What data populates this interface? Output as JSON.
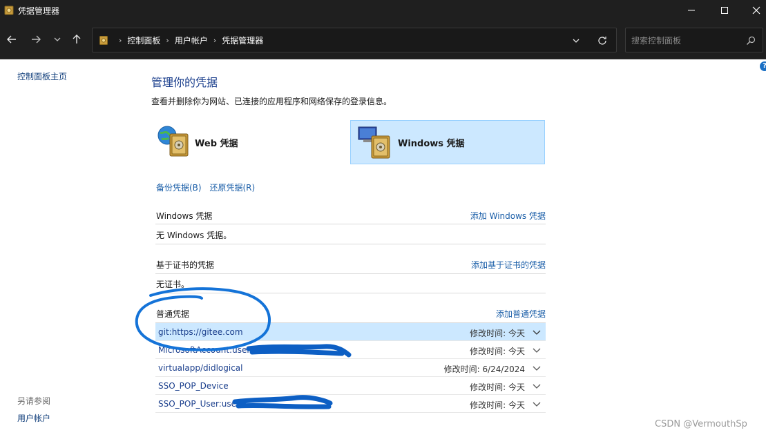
{
  "window": {
    "title": "凭据管理器"
  },
  "address_bar": {
    "breadcrumbs": [
      "控制面板",
      "用户帐户",
      "凭据管理器"
    ],
    "search_placeholder": "搜索控制面板"
  },
  "left_pane": {
    "home_link": "控制面板主页",
    "see_also_label": "另请参阅",
    "see_also_link": "用户帐户"
  },
  "main": {
    "heading": "管理你的凭据",
    "subtitle": "查看并删除你为网站、已连接的应用程序和网络保存的登录信息。",
    "credential_types": [
      {
        "label": "Web 凭据",
        "selected": false
      },
      {
        "label": "Windows 凭据",
        "selected": true
      }
    ],
    "backup_link": "备份凭据(B)",
    "restore_link": "还原凭据(R)",
    "sections": {
      "windows": {
        "title": "Windows 凭据",
        "add_link": "添加 Windows 凭据",
        "empty_text": "无 Windows 凭据。"
      },
      "certificate": {
        "title": "基于证书的凭据",
        "add_link": "添加基于证书的凭据",
        "empty_text": "无证书。"
      },
      "generic": {
        "title": "普通凭据",
        "add_link": "添加普通凭据",
        "items": [
          {
            "name": "git:https://gitee.com",
            "modified": "修改时间:  今天",
            "selected": true
          },
          {
            "name": "MicrosoftAccount:user=",
            "modified": "修改时间:  今天",
            "selected": false
          },
          {
            "name": "virtualapp/didlogical",
            "modified": "修改时间:  6/24/2024",
            "selected": false
          },
          {
            "name": "SSO_POP_Device",
            "modified": "修改时间:  今天",
            "selected": false
          },
          {
            "name": "SSO_POP_User:user=",
            "modified": "修改时间:  今天",
            "selected": false
          }
        ]
      }
    }
  },
  "watermark": "CSDN @VermouthSp",
  "colors": {
    "accent_blue": "#1a5ea8",
    "selected_bg": "#cce8ff",
    "annotation_ink": "#1473d8"
  }
}
